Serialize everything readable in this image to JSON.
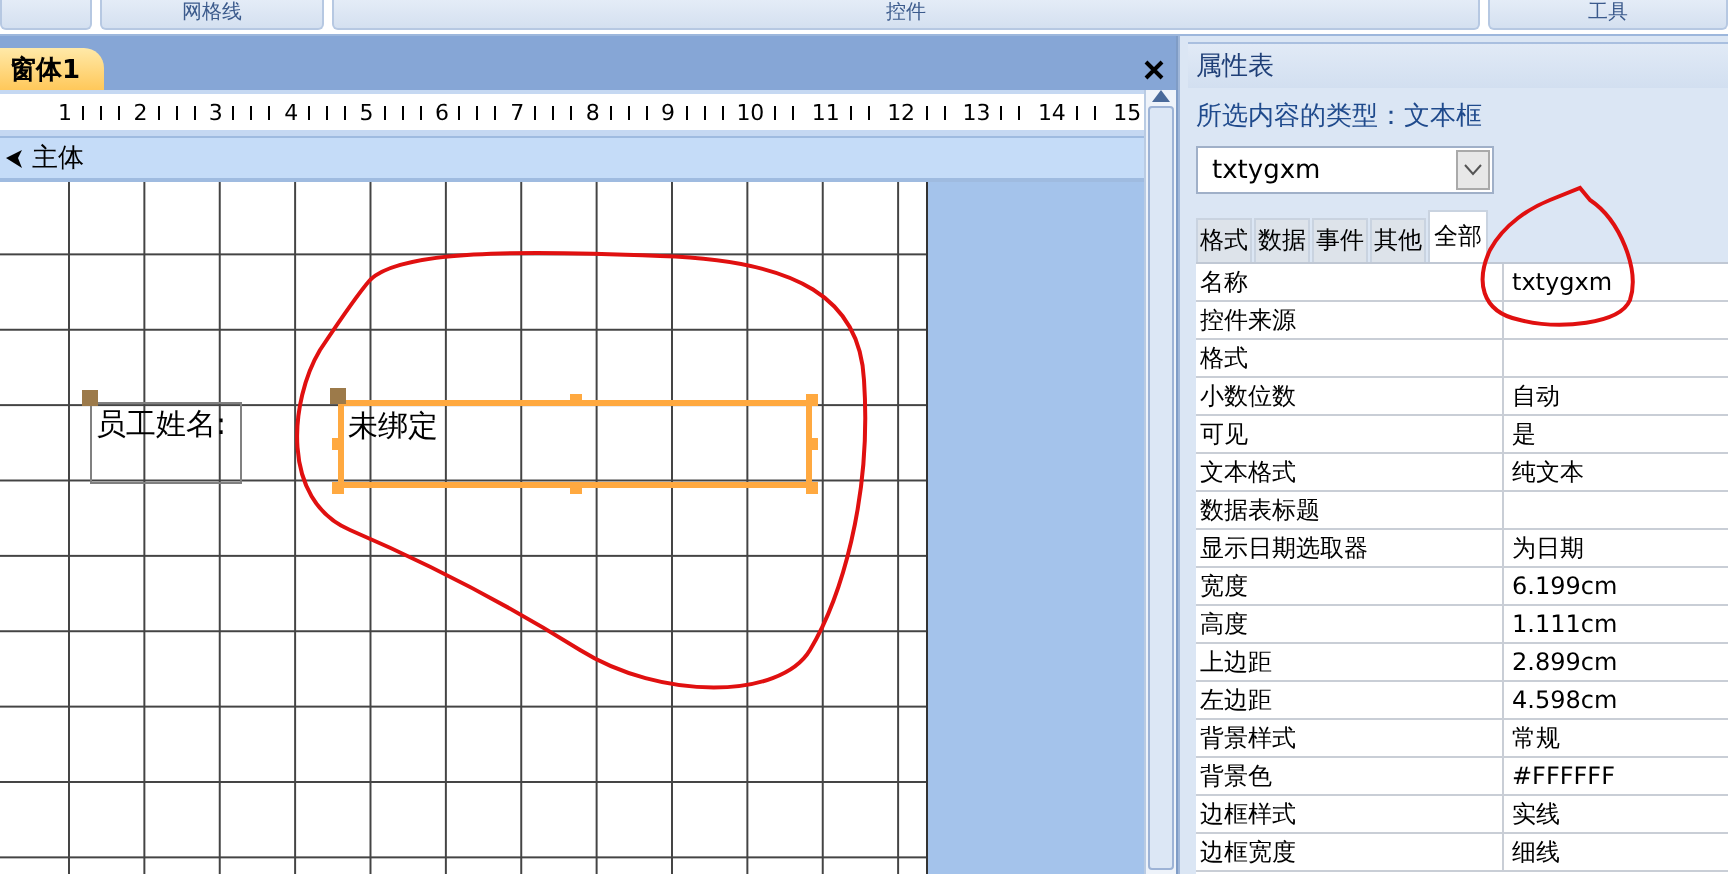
{
  "ribbon_groups": [
    "网格线",
    "控件",
    "工具"
  ],
  "document_tab": {
    "label": "窗体1",
    "selected": true
  },
  "ruler": {
    "marks": [
      "1",
      "2",
      "3",
      "4",
      "5",
      "6",
      "7",
      "8",
      "9",
      "10",
      "11",
      "12",
      "13",
      "14",
      "15"
    ]
  },
  "section": {
    "title": "主体"
  },
  "controls": [
    {
      "kind": "label",
      "text": "员工姓名:",
      "selected": false
    },
    {
      "kind": "textbox",
      "text": "未绑定",
      "selected": true
    }
  ],
  "property_sheet": {
    "title": "属性表",
    "selection_type": "所选内容的类型：文本框",
    "object_combo": "txtygxm",
    "tabs": [
      {
        "label": "格式",
        "selected": false
      },
      {
        "label": "数据",
        "selected": false
      },
      {
        "label": "事件",
        "selected": false
      },
      {
        "label": "其他",
        "selected": false
      },
      {
        "label": "全部",
        "selected": true
      }
    ],
    "properties": [
      {
        "name": "名称",
        "value": "txtygxm"
      },
      {
        "name": "控件来源"
      },
      {
        "name": "格式"
      },
      {
        "name": "小数位数",
        "value": "自动"
      },
      {
        "name": "可见",
        "value": "是"
      },
      {
        "name": "文本格式",
        "value": "纯文本"
      },
      {
        "name": "数据表标题"
      },
      {
        "name": "显示日期选取器",
        "value": "为日期"
      },
      {
        "name": "宽度",
        "value": "6.199cm"
      },
      {
        "name": "高度",
        "value": "1.111cm"
      },
      {
        "name": "上边距",
        "value": "2.899cm"
      },
      {
        "name": "左边距",
        "value": "4.598cm"
      },
      {
        "name": "背景样式",
        "value": "常规"
      },
      {
        "name": "背景色",
        "value": "#FFFFFF"
      },
      {
        "name": "边框样式",
        "value": "实线"
      },
      {
        "name": "边框宽度",
        "value": "细线"
      }
    ]
  }
}
